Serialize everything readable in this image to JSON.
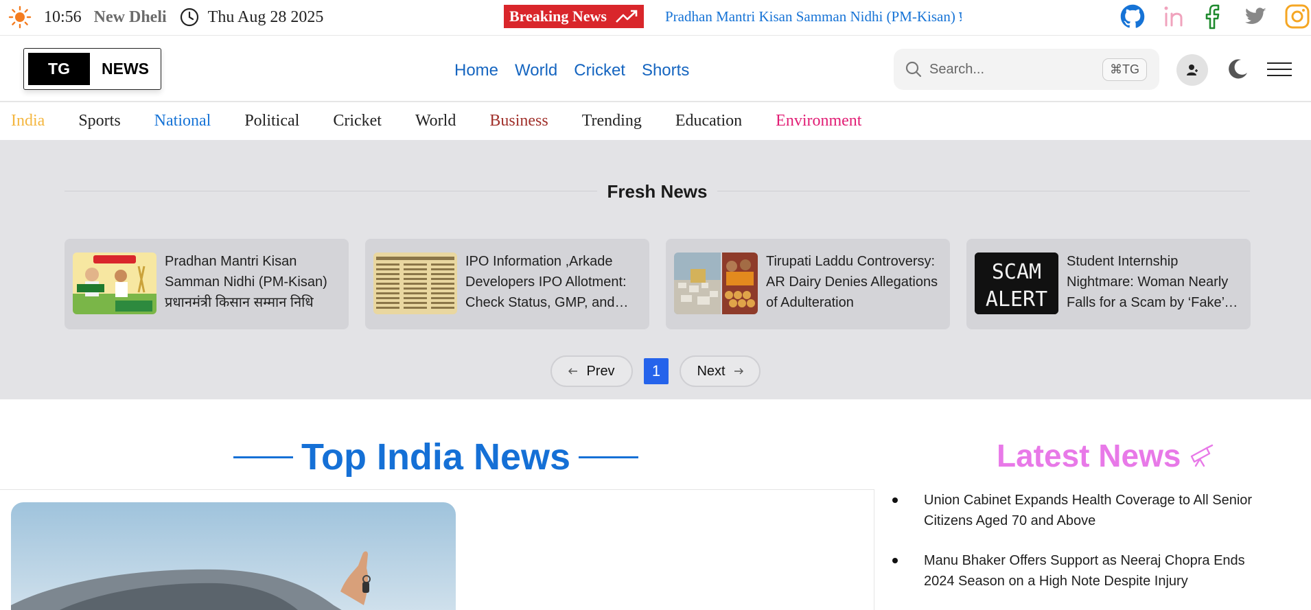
{
  "topbar": {
    "time": "10:56",
    "city": "New Dheli",
    "date": "Thu Aug 28 2025",
    "breaking_label": "Breaking News",
    "ticker_text": "Pradhan Mantri Kisan Samman Nidhi (PM-Kisan) प्रधानमंत्री किसान सम्मान निधि",
    "socials": [
      "github-icon",
      "linkedin-icon",
      "facebook-icon",
      "twitter-icon",
      "instagram-icon"
    ]
  },
  "header": {
    "logo_left": "TG",
    "logo_right": "NEWS",
    "nav": [
      "Home",
      "World",
      "Cricket",
      "Shorts"
    ],
    "search_placeholder": "Search...",
    "search_shortcut": "⌘TG"
  },
  "categories": [
    {
      "label": "India",
      "color": "#f4b63f"
    },
    {
      "label": "Sports",
      "color": "#222222"
    },
    {
      "label": "National",
      "color": "#1673d6"
    },
    {
      "label": "Political",
      "color": "#222222"
    },
    {
      "label": "Cricket",
      "color": "#222222"
    },
    {
      "label": "World",
      "color": "#222222"
    },
    {
      "label": "Business",
      "color": "#a0302a"
    },
    {
      "label": "Trending",
      "color": "#222222"
    },
    {
      "label": "Education",
      "color": "#222222"
    },
    {
      "label": "Environment",
      "color": "#e11d74"
    }
  ],
  "fresh": {
    "title": "Fresh News",
    "cards": [
      {
        "text": "Pradhan Mantri Kisan Samman Nidhi (PM-Kisan) प्रधानमंत्री किसान सम्मान निधि",
        "thumb": "pm-kisan-thumbnail"
      },
      {
        "text": "IPO Information ,Arkade Developers IPO Allotment: Check Status, GMP, and More",
        "thumb": "newspaper-thumbnail"
      },
      {
        "text": "Tirupati Laddu Controversy: AR Dairy Denies Allegations of Adulteration",
        "thumb": "tirupati-thumbnail"
      },
      {
        "text": "Student Internship Nightmare: Woman Nearly Falls for a Scam by ‘Fake’ Recruiter",
        "thumb": "scam-alert-thumbnail",
        "thumb_text": [
          "SCAM",
          "ALERT"
        ]
      }
    ],
    "pager": {
      "prev": "Prev",
      "page": "1",
      "next": "Next"
    }
  },
  "main": {
    "section_title": "Top India News"
  },
  "latest": {
    "title": "Latest News",
    "items": [
      "Union Cabinet Expands Health Coverage to All Senior Citizens Aged 70 and Above",
      "Manu Bhaker Offers Support as Neeraj Chopra Ends 2024 Season on a High Note Despite Injury"
    ]
  }
}
